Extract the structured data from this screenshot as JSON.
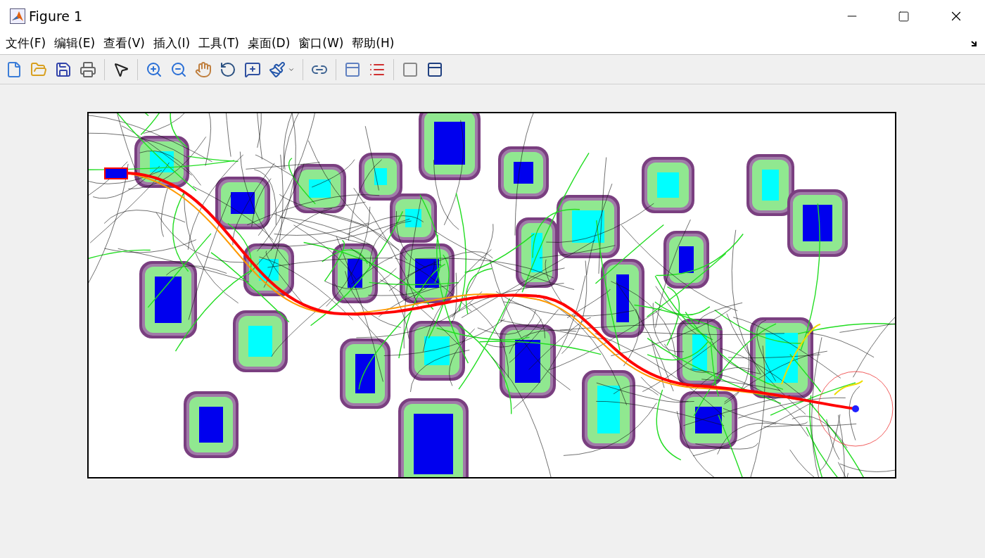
{
  "window": {
    "title": "Figure 1"
  },
  "menu": [
    {
      "label": "文件(F)"
    },
    {
      "label": "编辑(E)"
    },
    {
      "label": "查看(V)"
    },
    {
      "label": "插入(I)"
    },
    {
      "label": "工具(T)"
    },
    {
      "label": "桌面(D)"
    },
    {
      "label": "窗口(W)"
    },
    {
      "label": "帮助(H)"
    }
  ]
}
